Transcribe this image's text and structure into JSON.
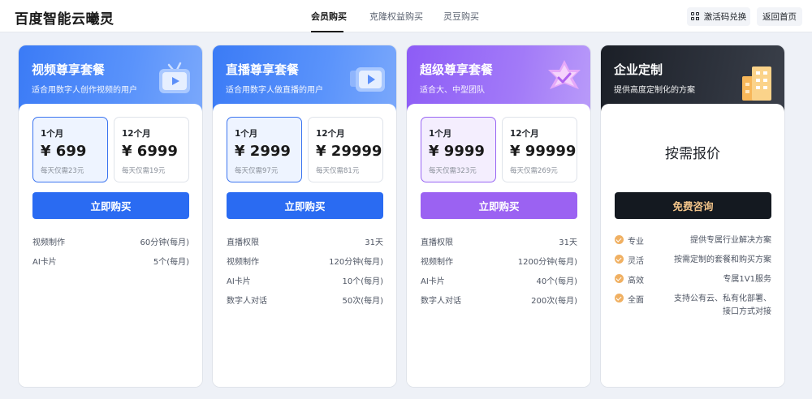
{
  "header": {
    "logo": "百度智能云曦灵",
    "tabs": [
      "会员购买",
      "克隆权益购买",
      "灵豆购买"
    ],
    "redeem_label": "激活码兑换",
    "home_label": "返回首页"
  },
  "plans": [
    {
      "title": "视频尊享套餐",
      "subtitle": "适合用数字人创作视频的用户",
      "options": [
        {
          "period": "1个月",
          "price": "¥ 699",
          "daily": "每天仅需23元"
        },
        {
          "period": "12个月",
          "price": "¥ 6999",
          "daily": "每天仅需19元"
        }
      ],
      "buy_label": "立即购买",
      "features": [
        {
          "name": "视频制作",
          "value": "60分钟(每月)"
        },
        {
          "name": "AI卡片",
          "value": "5个(每月)"
        }
      ]
    },
    {
      "title": "直播尊享套餐",
      "subtitle": "适合用数字人做直播的用户",
      "options": [
        {
          "period": "1个月",
          "price": "¥ 2999",
          "daily": "每天仅需97元"
        },
        {
          "period": "12个月",
          "price": "¥ 29999",
          "daily": "每天仅需81元"
        }
      ],
      "buy_label": "立即购买",
      "features": [
        {
          "name": "直播权限",
          "value": "31天"
        },
        {
          "name": "视频制作",
          "value": "120分钟(每月)"
        },
        {
          "name": "AI卡片",
          "value": "10个(每月)"
        },
        {
          "name": "数字人对话",
          "value": "50次(每月)"
        }
      ]
    },
    {
      "title": "超级尊享套餐",
      "subtitle": "适合大、中型团队",
      "options": [
        {
          "period": "1个月",
          "price": "¥ 9999",
          "daily": "每天仅需323元"
        },
        {
          "period": "12个月",
          "price": "¥ 99999",
          "daily": "每天仅需269元"
        }
      ],
      "buy_label": "立即购买",
      "features": [
        {
          "name": "直播权限",
          "value": "31天"
        },
        {
          "name": "视频制作",
          "value": "1200分钟(每月)"
        },
        {
          "name": "AI卡片",
          "value": "40个(每月)"
        },
        {
          "name": "数字人对话",
          "value": "200次(每月)"
        }
      ]
    }
  ],
  "enterprise": {
    "title": "企业定制",
    "subtitle": "提供高度定制化的方案",
    "price_label": "按需报价",
    "button_label": "免费咨询",
    "features": [
      {
        "name": "专业",
        "value": "提供专属行业解决方案"
      },
      {
        "name": "灵活",
        "value": "按需定制的套餐和购买方案"
      },
      {
        "name": "高效",
        "value": "专属1V1服务"
      },
      {
        "name": "全面",
        "value": "支持公有云、私有化部署、接口方式对接"
      }
    ]
  },
  "colors": {
    "video_accent": "#2a6bf2",
    "super_accent": "#9b62f2",
    "enterprise_button": "#141920",
    "enterprise_button_text": "#f3c58a",
    "check": "#f0b062"
  },
  "icons": {
    "header": [
      "qr-code-icon"
    ],
    "plans": [
      "tv-play-icon",
      "tv-play-icon",
      "star-badge-icon",
      "building-icon"
    ]
  }
}
